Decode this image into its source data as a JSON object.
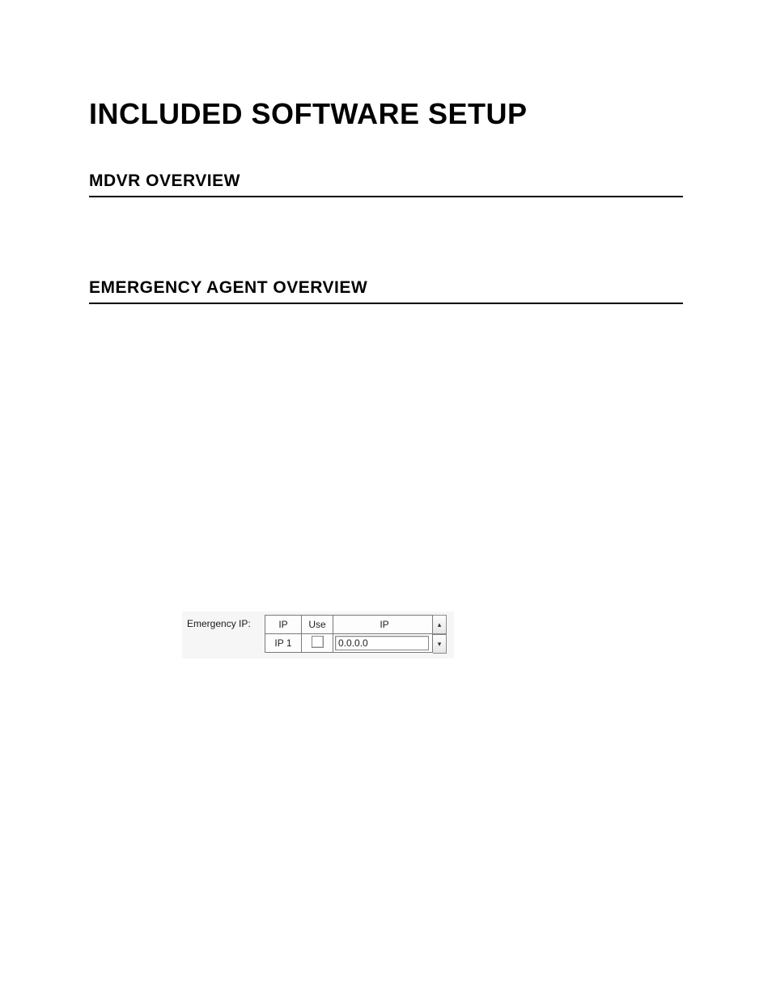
{
  "title": "INCLUDED SOFTWARE SETUP",
  "sections": {
    "mdvr": "MDVR OVERVIEW",
    "emergency": "EMERGENCY AGENT OVERVIEW"
  },
  "emergency_ip": {
    "label": "Emergency IP:",
    "headers": {
      "ip_col": "IP",
      "use_col": "Use",
      "ip_val_col": "IP"
    },
    "rows": [
      {
        "label": "IP 1",
        "use": false,
        "value": "0.0.0.0"
      }
    ]
  },
  "scroll": {
    "up": "▴",
    "down": "▾"
  }
}
